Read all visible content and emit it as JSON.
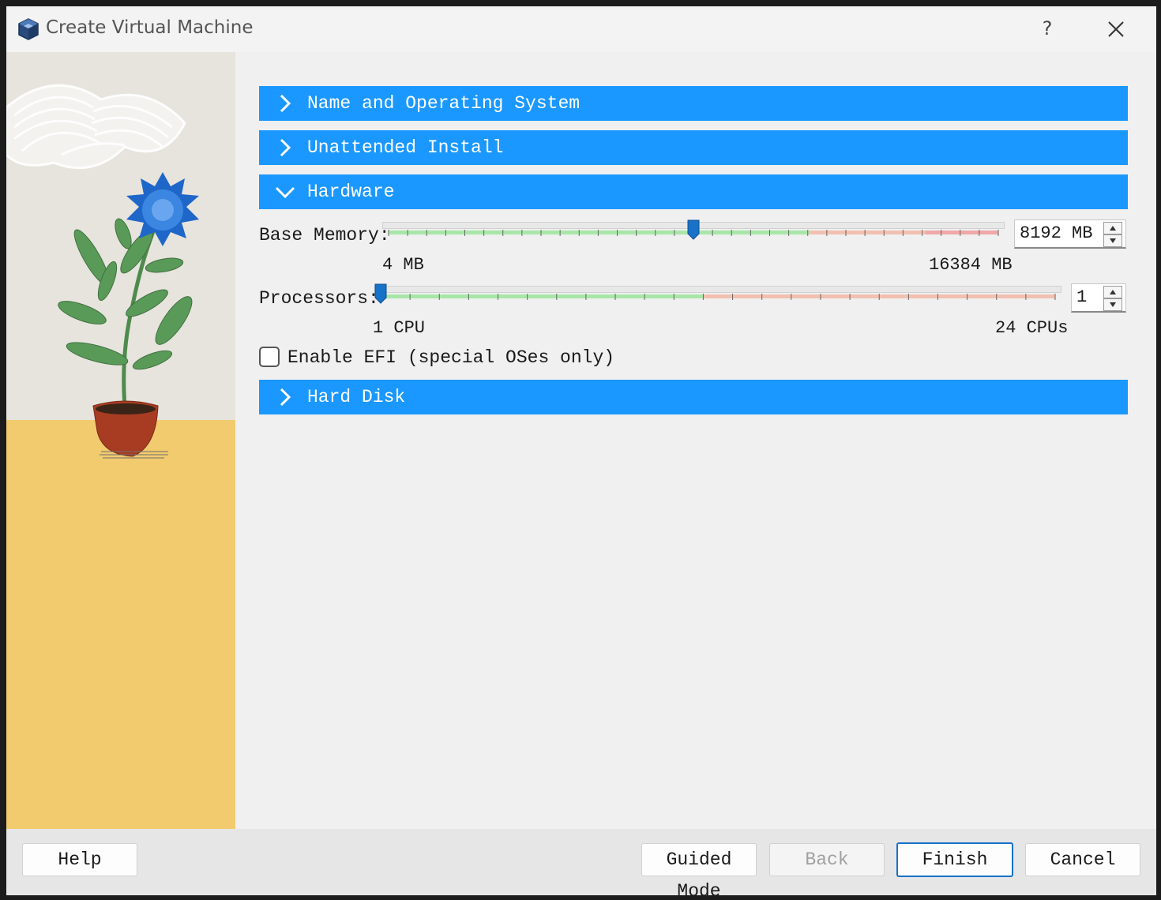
{
  "window": {
    "title": "Create Virtual Machine",
    "help_label": "?"
  },
  "sections": {
    "name_os": "Name and Operating System",
    "unattended": "Unattended Install",
    "hardware": "Hardware",
    "hard_disk": "Hard Disk"
  },
  "hardware": {
    "memory": {
      "label": "Base Memory:",
      "value": "8192 MB",
      "min_label": "4 MB",
      "max_label": "16384 MB",
      "min": 4,
      "max": 16384,
      "current": 8192
    },
    "processors": {
      "label": "Processors:",
      "value": "1",
      "min_label": "1 CPU",
      "max_label": "24 CPUs",
      "min": 1,
      "max": 24,
      "current": 1
    },
    "efi_label": "Enable EFI (special OSes only)",
    "efi_checked": false
  },
  "buttons": {
    "help": "Help",
    "guided_mode": "Guided Mode",
    "back": "Back",
    "finish": "Finish",
    "cancel": "Cancel"
  },
  "colors": {
    "accent": "#1a98ff",
    "slider_handle": "#1872c8",
    "safe_zone": "#a8e6a8",
    "warn_zone": "#f2c0b0",
    "danger_zone": "#f0a8a8",
    "illustration_floor": "#f2cb6e"
  },
  "icons": {
    "app": "virtualbox-cube-icon",
    "close": "close-icon",
    "section_collapsed": "chevron-right-icon",
    "section_expanded": "chevron-down-icon"
  }
}
